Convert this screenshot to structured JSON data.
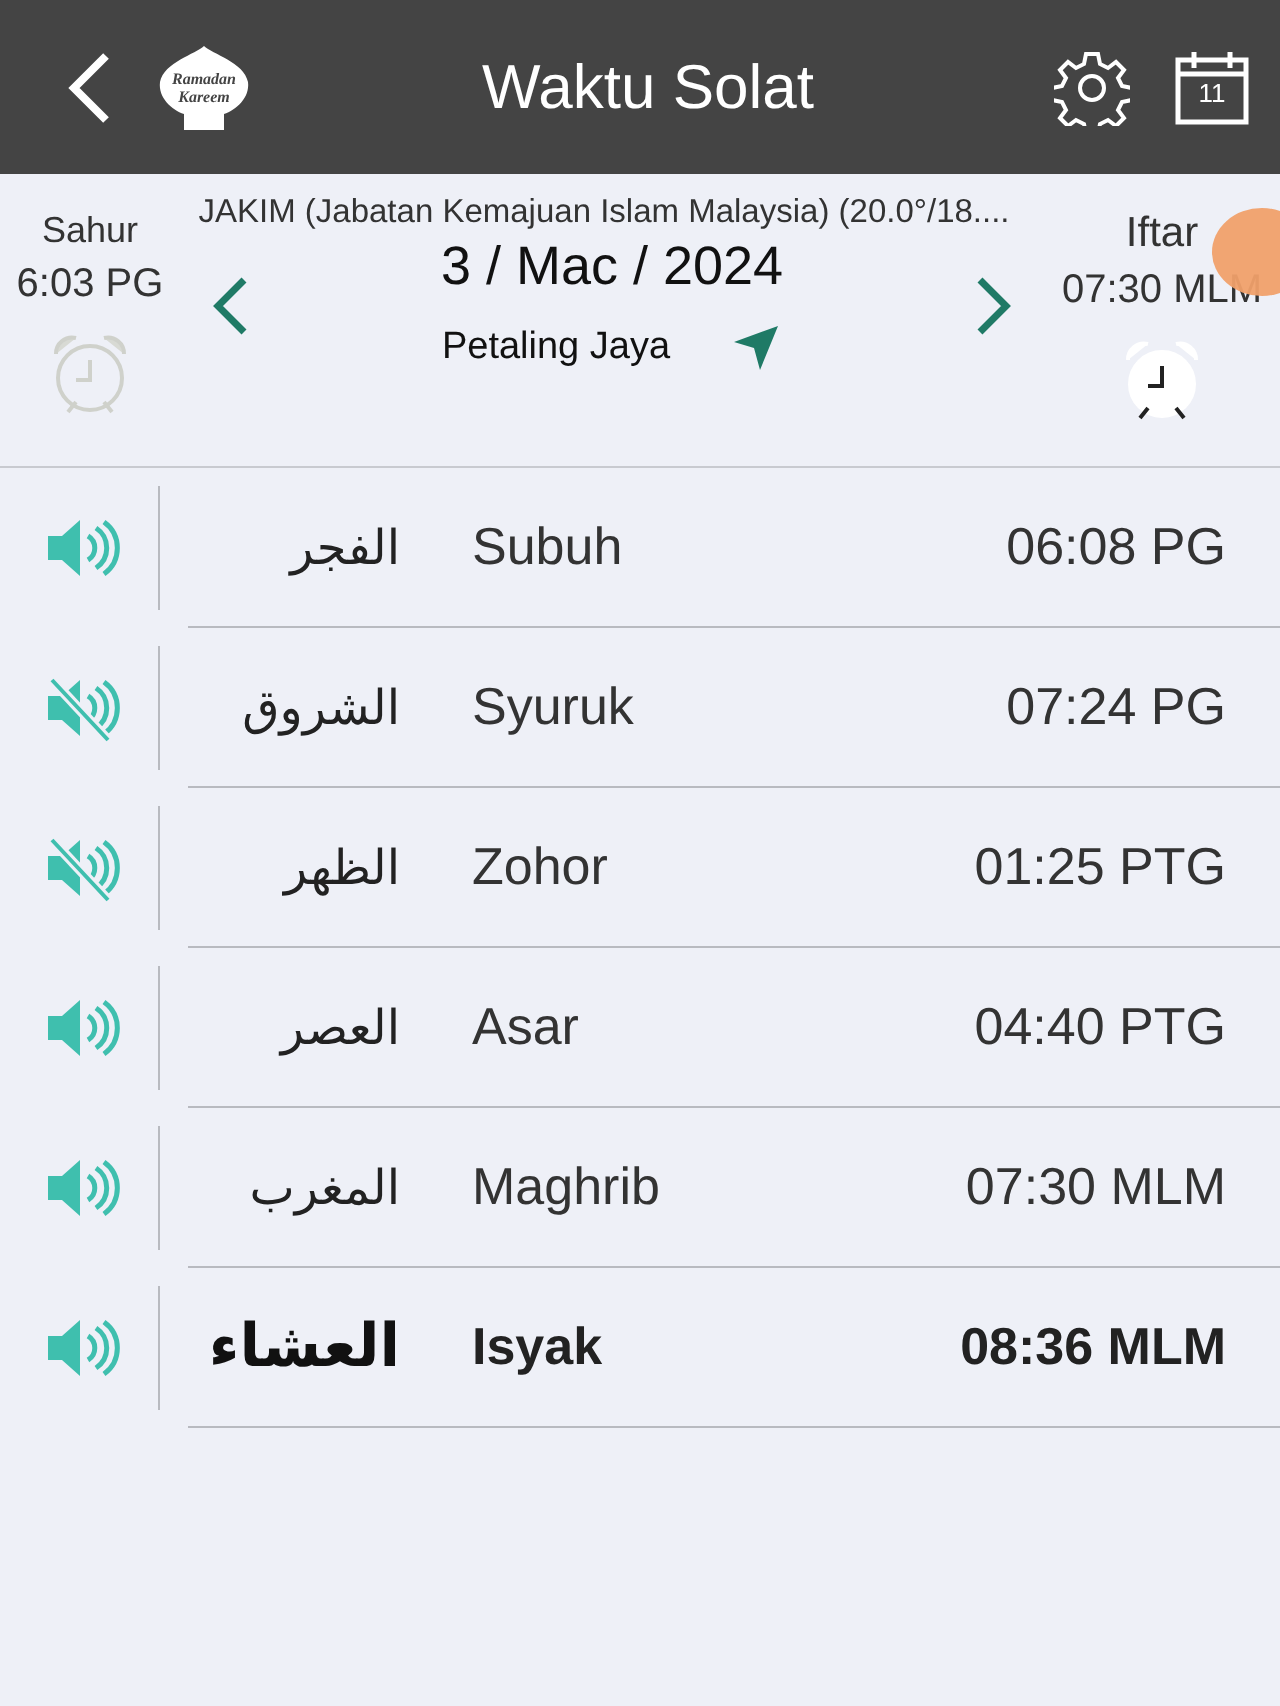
{
  "app_bar": {
    "title": "Waktu Solat",
    "logo_text": [
      "Ramadan",
      "Kareem"
    ],
    "calendar_day": "11"
  },
  "info": {
    "method": "JAKIM (Jabatan Kemajuan Islam Malaysia) (20.0°/18....",
    "date": "3 / Mac / 2024",
    "location": "Petaling Jaya",
    "sahur": {
      "label": "Sahur",
      "time": "6:03 PG",
      "alarm_on": false
    },
    "iftar": {
      "label": "Iftar",
      "time": "07:30 MLM",
      "alarm_on": true
    }
  },
  "prayers": [
    {
      "arabic": "الفجر",
      "name": "Subuh",
      "time": "06:08 PG",
      "sound_on": true,
      "selected": false
    },
    {
      "arabic": "الشروق",
      "name": "Syuruk",
      "time": "07:24 PG",
      "sound_on": false,
      "selected": false
    },
    {
      "arabic": "الظهر",
      "name": "Zohor",
      "time": "01:25 PTG",
      "sound_on": false,
      "selected": false
    },
    {
      "arabic": "العصر",
      "name": "Asar",
      "time": "04:40 PTG",
      "sound_on": true,
      "selected": false
    },
    {
      "arabic": "المغرب",
      "name": "Maghrib",
      "time": "07:30 MLM",
      "sound_on": true,
      "selected": false
    },
    {
      "arabic": "العشاء",
      "name": "Isyak",
      "time": "08:36 MLM",
      "sound_on": true,
      "selected": true
    }
  ]
}
